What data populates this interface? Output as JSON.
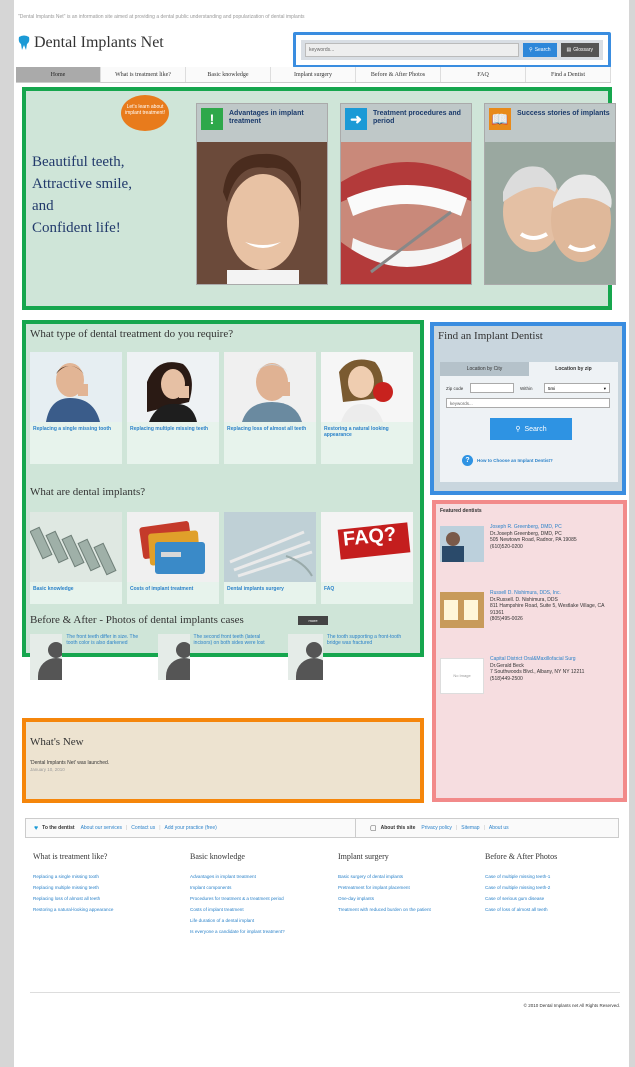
{
  "header": {
    "tagline": "\"Dental Implants Net\" is an information site aimed at providing a dental public understanding and popularization of dental implants",
    "logo": "Dental Implants Net",
    "search_placeholder": "keywords...",
    "search_label": "Search",
    "glossary_label": "Glossary"
  },
  "nav": [
    "Home",
    "What is treatment like?",
    "Basic knowledge",
    "Implant surgery",
    "Before & After Photos",
    "FAQ",
    "Find a Dentist"
  ],
  "hero": {
    "lines": [
      "Beautiful teeth,",
      "Attractive smile,",
      "and",
      "Confident life!"
    ],
    "bubble": "Let's learn about implant treatment!",
    "features": [
      {
        "title": "Advantages in implant treatment",
        "icon": "exclamation-icon",
        "color": "#2ea84a"
      },
      {
        "title": "Treatment procedures and period",
        "icon": "arrow-right-icon",
        "color": "#1b9ad6"
      },
      {
        "title": "Success stories of implants",
        "icon": "book-icon",
        "color": "#e88a1a"
      }
    ]
  },
  "treatment": {
    "title": "What type of dental treatment do you require?",
    "items": [
      "Replacing a single missing tooth",
      "Replacing multiple missing teeth",
      "Replacing loss of almost all teeth",
      "Restoring a natural looking appearance"
    ]
  },
  "implants": {
    "title": "What are dental implants?",
    "items": [
      "Basic knowledge",
      "Costs of implant treatment",
      "Dental implants surgery",
      "FAQ"
    ],
    "faq_sign": "FAQ?"
  },
  "before_after": {
    "title": "Before & After - Photos of dental implants cases",
    "more": "more",
    "items": [
      "The front teeth differ in size. The tooth color is also darkened",
      "The second front teeth (lateral incisors) on both sides were lost",
      "The tooth supporting a front-tooth bridge was fractured"
    ]
  },
  "find": {
    "title": "Find an Implant Dentist",
    "tab_city": "Location by City",
    "tab_zip": "Location by zip",
    "zip_label": "Zip code",
    "within_label": "Within",
    "within_value": "5mi",
    "keyword_placeholder": "keywords...",
    "search_label": "Search",
    "help_link": "How to Choose an Implant Dentist?"
  },
  "featured": {
    "title": "Featured dentists",
    "no_image": "No Image",
    "dentists": [
      {
        "name": "Joseph R. Greenberg, DMD, PC",
        "doctor": "Dr.Joseph Greenberg, DMD, PC",
        "address": "505 Newtown Road, Radnor, PA 19085",
        "phone": "(610)520-0200"
      },
      {
        "name": "Russell D. Nishimura, DDS, Inc.",
        "doctor": "Dr.Russell. D. Nishimura, DDS",
        "address": "811 Hampshire Road, Suite 5, Westlake Village, CA 91361",
        "phone": "(805)495-0026"
      },
      {
        "name": "Capital District Oral&Maxillofacial Surg",
        "doctor": "Dr.Gerald Beck",
        "address": "7 Southwoods Blvd., Albany, NY NY 12211",
        "phone": "(518)449-2500"
      }
    ]
  },
  "news": {
    "title": "What's New",
    "item": "'Dental Implants Net' was launched.",
    "date": "January 10, 2010"
  },
  "footer": {
    "dentist_label": "To the dentist",
    "dentist_links": [
      "About our services",
      "Contact us",
      "Add your practice (free)"
    ],
    "site_label": "About this site",
    "site_links": [
      "Privacy policy",
      "Sitemap",
      "About us"
    ],
    "columns": [
      {
        "title": "What is treatment like?",
        "links": [
          "Replacing a single missing tooth",
          "Replacing multiple missing teeth",
          "Replacing loss of almost all teeth",
          "Restoring a natural-looking appearance"
        ]
      },
      {
        "title": "Basic knowledge",
        "links": [
          "Advantages in implant treatment",
          "Implant components",
          "Procedures for treatment & a treatment period",
          "Costs of implant treatment",
          "Life duration of a dental implant",
          "Is everyone a candidate for implant treatment?"
        ]
      },
      {
        "title": "Implant surgery",
        "links": [
          "Basic surgery of dental implants",
          "Pretreatment for implant placement",
          "One-day implants",
          "Treatment with reduced burden on the patient"
        ]
      },
      {
        "title": "Before & After Photos",
        "links": [
          "Case of multiple missing teeth-1",
          "Case of multiple missing teeth-2",
          "Case of serious gum disease",
          "Case of loss of almost all teeth"
        ]
      }
    ],
    "copyright": "© 2010 Dental Implants net All Rights Reserved."
  },
  "colors": {
    "accent": "#2b82c9",
    "green_box": "#16a64e",
    "blue_box": "#3a8de0",
    "pink_box": "#f28a8a",
    "orange_box": "#f5860b"
  }
}
